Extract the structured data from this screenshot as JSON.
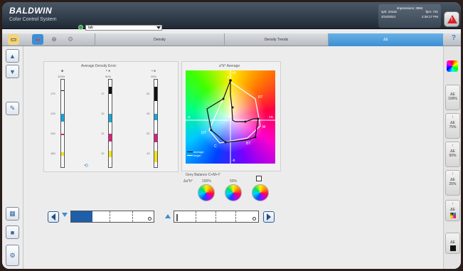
{
  "header": {
    "brand": "BALDWIN",
    "product": "Color Control System",
    "job_value": "tab",
    "stats": {
      "impressions_label": "Impressions: 3984",
      "sph": "sph: 23116",
      "fpm": "fpm: 731",
      "date": "3/16/2024",
      "time": "2:38:17 PM"
    }
  },
  "tabs": {
    "density": "Density",
    "density_trends": "Density Trends",
    "delta_e": "ΔE",
    "help": "?"
  },
  "density_panel": {
    "title": "Average Density Error:",
    "columns": [
      {
        "dots": "■",
        "percent": "100%",
        "values": [
          "170",
          "125",
          "140",
          "160"
        ]
      },
      {
        "dots": "• ●",
        "percent": "50%",
        "values": [
          "17",
          "10",
          "12",
          "10"
        ]
      },
      {
        "dots": "•.●",
        "percent": "25%",
        "values": [
          "20",
          "15",
          "20",
          "13"
        ]
      }
    ]
  },
  "chart_panel": {
    "title": "a*b* Average",
    "axis_labels": {
      "top": "+b",
      "bottom": "-b",
      "left": "-a",
      "right": "+a"
    },
    "points": [
      "Y",
      "RT",
      "M",
      "BT",
      "C",
      "GT"
    ],
    "legend": [
      "average",
      "target"
    ]
  },
  "grey_balance": {
    "title": "Grey Balance C+M+Y",
    "label": "Δa*b*",
    "levels": [
      "100%",
      "50%"
    ]
  },
  "right_sidebar": {
    "items": [
      {
        "label": "ΔE",
        "sub": "100%"
      },
      {
        "label": "ΔE",
        "sub": "75%"
      },
      {
        "label": "ΔE",
        "sub": "50%"
      },
      {
        "label": "ΔE",
        "sub": "25%"
      },
      {
        "label": "ΔE",
        "sub": ""
      }
    ]
  },
  "colors": {
    "accent_blue": "#3b8fd4",
    "alarm_red": "#d4232a",
    "dark_header": "#1f2a36"
  }
}
